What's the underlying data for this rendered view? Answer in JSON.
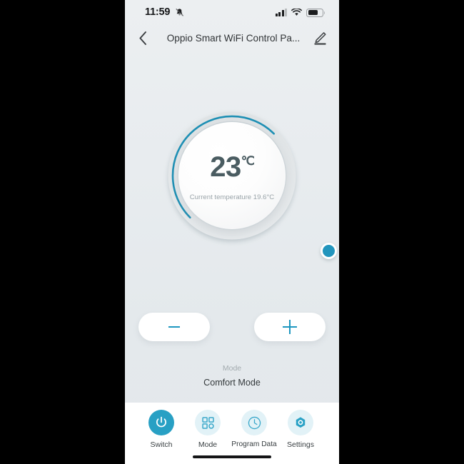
{
  "status_bar": {
    "time": "11:59",
    "mute_icon": "bell-slash-icon",
    "signal_icon": "cellular-signal-icon",
    "wifi_icon": "wifi-icon",
    "battery_icon": "battery-icon",
    "battery_level_percent": 62,
    "signal_bars_filled": 3,
    "signal_bars_total": 4
  },
  "header": {
    "back_icon": "chevron-left-icon",
    "title": "Oppio Smart WiFi Control Pa...",
    "edit_icon": "pencil-edit-icon"
  },
  "dial": {
    "setpoint": "23",
    "unit": "℃",
    "current_temperature_text": "Current temperature 19.6°C",
    "arc_color": "#1e90b5",
    "track_color": "#e2e5e7",
    "knob_color": "#2295bd",
    "arc_start_deg": 135,
    "arc_end_deg": 45,
    "knob_angle_deg": 45
  },
  "steppers": {
    "minus_label": "−",
    "minus_icon": "minus-icon",
    "plus_label": "+",
    "plus_icon": "plus-icon",
    "icon_color": "#1e97c0"
  },
  "mode": {
    "label": "Mode",
    "value": "Comfort  Mode"
  },
  "bottom_nav": {
    "items": [
      {
        "id": "switch",
        "label": "Switch",
        "icon": "power-icon",
        "active": true
      },
      {
        "id": "mode",
        "label": "Mode",
        "icon": "grid-squares-icon",
        "active": false
      },
      {
        "id": "program",
        "label": "Program Data",
        "icon": "clock-icon",
        "active": false
      },
      {
        "id": "settings",
        "label": "Settings",
        "icon": "hex-gear-icon",
        "active": false
      }
    ],
    "active_bg": "#28a0c4",
    "inactive_bg": "#e2f2f7",
    "icon_color": "#3aa8ca"
  },
  "home_indicator": "home-indicator-bar"
}
